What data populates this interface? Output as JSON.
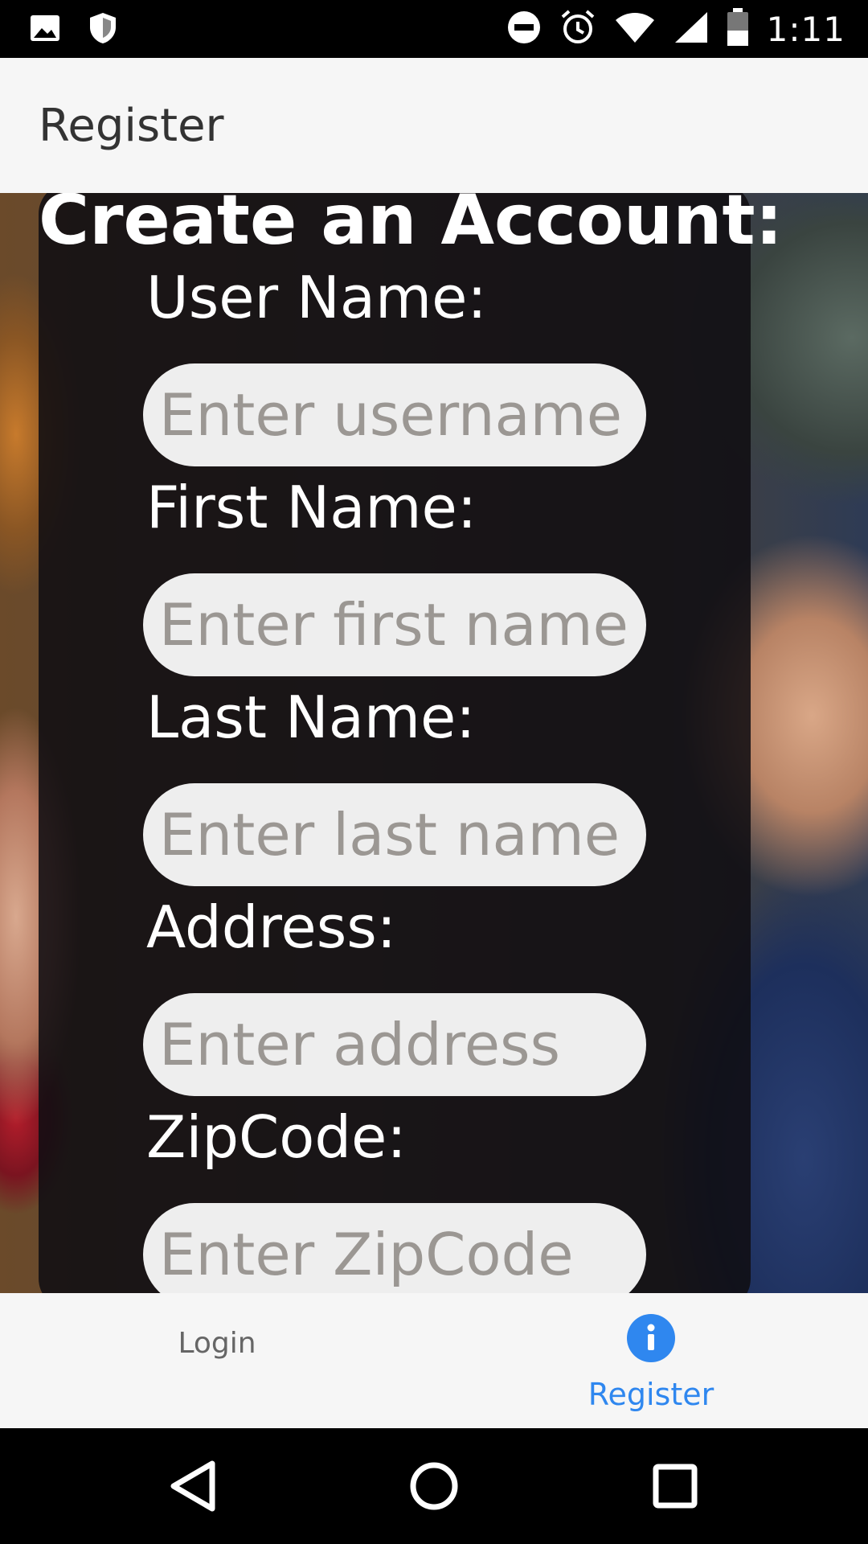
{
  "status_bar": {
    "time": "1:11",
    "left_icons": [
      "image-icon",
      "shield-icon"
    ],
    "right_icons": [
      "do-not-disturb-icon",
      "alarm-icon",
      "wifi-icon",
      "cell-signal-icon",
      "battery-icon"
    ]
  },
  "header": {
    "title": "Register"
  },
  "form": {
    "heading": "Create an Account:",
    "fields": [
      {
        "label": "User Name:",
        "placeholder": "Enter username",
        "value": ""
      },
      {
        "label": "First Name:",
        "placeholder": "Enter first name",
        "value": ""
      },
      {
        "label": "Last Name:",
        "placeholder": "Enter last name",
        "value": ""
      },
      {
        "label": "Address:",
        "placeholder": "Enter address",
        "value": ""
      },
      {
        "label": "ZipCode:",
        "placeholder": "Enter ZipCode",
        "value": ""
      }
    ]
  },
  "tabs": [
    {
      "label": "Login",
      "active": false
    },
    {
      "label": "Register",
      "active": true,
      "icon": "info-icon"
    }
  ],
  "colors": {
    "accent": "#2f87ef",
    "header_bg": "#f6f6f6",
    "card_bg": "#100e12"
  },
  "nav_bar": {
    "buttons": [
      "back-icon",
      "home-icon",
      "recents-icon"
    ]
  }
}
